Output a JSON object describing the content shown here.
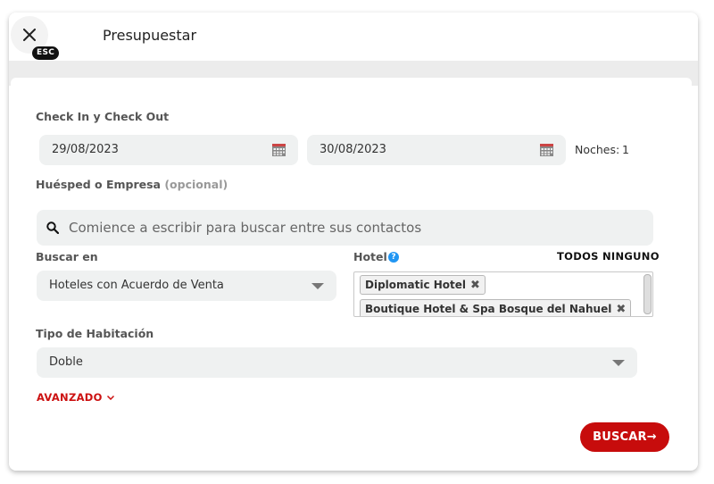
{
  "header": {
    "title": "Presupuestar",
    "esc_badge": "ESC"
  },
  "checkin": {
    "label": "Check In y Check Out",
    "checkin_date": "29/08/2023",
    "checkout_date": "30/08/2023",
    "nights_label": "Noches:",
    "nights_value": "1"
  },
  "guest": {
    "label": "Huésped o Empresa",
    "optional": "(opcional)",
    "placeholder": "Comience a escribir para buscar entre sus contactos"
  },
  "search_in": {
    "label": "Buscar en",
    "selected": "Hoteles con Acuerdo de Venta"
  },
  "hotel": {
    "label": "Hotel",
    "help": "?",
    "all_label": "TODOS",
    "none_label": "NINGUNO",
    "chips": [
      "Diplomatic Hotel",
      "Boutique Hotel & Spa Bosque del Nahuel"
    ],
    "remove_glyph": "✖"
  },
  "room_type": {
    "label": "Tipo de Habitación",
    "selected": "Doble"
  },
  "advanced": {
    "label": "AVANZADO"
  },
  "search_button": {
    "label": "BUSCAR",
    "arrow": "→"
  },
  "colors": {
    "accent": "#c70c0c",
    "field_bg": "#eff1f1",
    "help_blue": "#2196f3"
  },
  "icons": {
    "close": "close-icon",
    "calendar": "calendar-icon",
    "search": "search-icon",
    "caret": "caret-down-icon",
    "chevron": "chevron-down-icon"
  }
}
